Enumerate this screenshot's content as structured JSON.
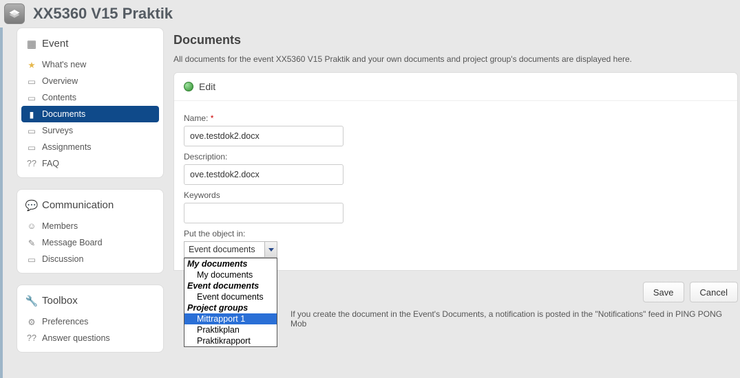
{
  "header": {
    "title": "XX5360 V15 Praktik"
  },
  "sidebar": {
    "sections": [
      {
        "title": "Event",
        "items": [
          {
            "label": "What's new",
            "icon": "star"
          },
          {
            "label": "Overview",
            "icon": "page"
          },
          {
            "label": "Contents",
            "icon": "page"
          },
          {
            "label": "Documents",
            "icon": "doc",
            "active": true
          },
          {
            "label": "Surveys",
            "icon": "page"
          },
          {
            "label": "Assignments",
            "icon": "page"
          },
          {
            "label": "FAQ",
            "icon": "question"
          }
        ]
      },
      {
        "title": "Communication",
        "items": [
          {
            "label": "Members",
            "icon": "person"
          },
          {
            "label": "Message Board",
            "icon": "pin"
          },
          {
            "label": "Discussion",
            "icon": "page"
          }
        ]
      },
      {
        "title": "Toolbox",
        "items": [
          {
            "label": "Preferences",
            "icon": "gear"
          },
          {
            "label": "Answer questions",
            "icon": "question"
          }
        ]
      }
    ]
  },
  "main": {
    "heading": "Documents",
    "description": "All documents for the event XX5360 V15 Praktik and your own documents and project group's documents are displayed here.",
    "edit_title": "Edit",
    "labels": {
      "name": "Name:",
      "desc": "Description:",
      "keywords": "Keywords",
      "put_in": "Put the object in:"
    },
    "values": {
      "name": "ove.testdok2.docx",
      "desc": "ove.testdok2.docx",
      "keywords": ""
    },
    "select": {
      "current": "Event documents",
      "groups": [
        {
          "label": "My documents",
          "options": [
            "My documents"
          ]
        },
        {
          "label": "Event documents",
          "options": [
            "Event documents"
          ]
        },
        {
          "label": "Project groups",
          "options": [
            "Mittrapport 1",
            "Praktikplan",
            "Praktikrapport"
          ]
        }
      ],
      "highlighted": "Mittrapport 1"
    },
    "buttons": {
      "save": "Save",
      "cancel": "Cancel"
    },
    "footer_note": "If you create the document in the Event's Documents, a notification is posted in the \"Notifications\" feed in PING PONG Mob"
  }
}
